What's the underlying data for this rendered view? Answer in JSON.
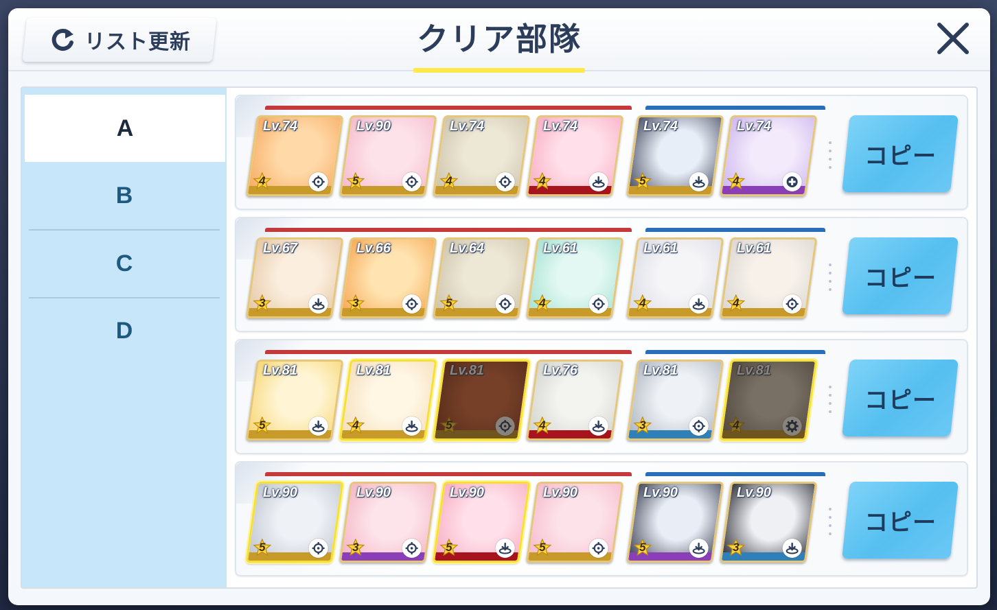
{
  "header": {
    "refresh_label": "リスト更新",
    "title": "クリア部隊"
  },
  "sidebar": {
    "items": [
      {
        "label": "A",
        "active": true
      },
      {
        "label": "B",
        "active": false
      },
      {
        "label": "C",
        "active": false
      },
      {
        "label": "D",
        "active": false
      }
    ]
  },
  "colors": {
    "striker_bar": "#c43a3a",
    "special_bar": "#2a6db8",
    "copy_button": "#55bff0",
    "title_underline": "#ffe94d"
  },
  "copy_label": "コピー",
  "teams": [
    {
      "strikers": [
        {
          "level": "Lv.74",
          "stars": "4",
          "role": "crosshair-icon",
          "base": "#c89a2a",
          "art": [
            "#ffd9a8",
            "#f5a65a"
          ]
        },
        {
          "level": "Lv.90",
          "stars": "5",
          "role": "crosshair-icon",
          "base": "#c89a2a",
          "art": [
            "#fde2ea",
            "#f4b6c8"
          ]
        },
        {
          "level": "Lv.74",
          "stars": "4",
          "role": "crosshair-icon",
          "base": "#c89a2a",
          "art": [
            "#ede7d6",
            "#c9c0a6"
          ]
        },
        {
          "level": "Lv.74",
          "stars": "4",
          "role": "tank-icon",
          "base": "#a8141e",
          "art": [
            "#ffe0ea",
            "#f8a7c0"
          ]
        }
      ],
      "specials": [
        {
          "level": "Lv.74",
          "stars": "5",
          "role": "tank-icon",
          "base": "#c89a2a",
          "art": [
            "#e8eef7",
            "#3b3f55"
          ]
        },
        {
          "level": "Lv.74",
          "stars": "4",
          "role": "heal-icon",
          "base": "#8a3fb8",
          "art": [
            "#f3eafb",
            "#c9b1ee"
          ]
        }
      ]
    },
    {
      "strikers": [
        {
          "level": "Lv.67",
          "stars": "3",
          "role": "tank-icon",
          "base": "#c89a2a",
          "art": [
            "#fbeede",
            "#e2c39e"
          ]
        },
        {
          "level": "Lv.66",
          "stars": "3",
          "role": "crosshair-icon",
          "base": "#c89a2a",
          "art": [
            "#ffe3b0",
            "#f6a24c"
          ]
        },
        {
          "level": "Lv.64",
          "stars": "5",
          "role": "crosshair-icon",
          "base": "#c89a2a",
          "art": [
            "#ede7d6",
            "#c9c0a6"
          ]
        },
        {
          "level": "Lv.61",
          "stars": "4",
          "role": "crosshair-icon",
          "base": "#c89a2a",
          "art": [
            "#e3f8f2",
            "#9fe0d0"
          ]
        }
      ],
      "specials": [
        {
          "level": "Lv.61",
          "stars": "4",
          "role": "tank-icon",
          "base": "#c89a2a",
          "art": [
            "#f5f5f8",
            "#d7d8e0"
          ]
        },
        {
          "level": "Lv.61",
          "stars": "4",
          "role": "crosshair-icon",
          "base": "#c89a2a",
          "art": [
            "#f7f1ea",
            "#d8d3cf"
          ]
        }
      ]
    },
    {
      "strikers": [
        {
          "level": "Lv.81",
          "stars": "5",
          "role": "tank-icon",
          "base": "#c89a2a",
          "art": [
            "#fff5d4",
            "#f6d36a"
          ],
          "gold": false
        },
        {
          "level": "Lv.81",
          "stars": "4",
          "role": "tank-icon",
          "base": "#c89a2a",
          "art": [
            "#fff6e4",
            "#f3dcb6"
          ],
          "gold": true
        },
        {
          "level": "Lv.81",
          "stars": "5",
          "role": "crosshair-icon",
          "base": "#c89a2a",
          "art": [
            "#d46a40",
            "#8a3a22"
          ],
          "gold": true,
          "dim": true
        },
        {
          "level": "Lv.76",
          "stars": "4",
          "role": "tank-icon",
          "base": "#a8141e",
          "art": [
            "#f3f3f0",
            "#cfd0c8"
          ],
          "gold": false
        }
      ],
      "specials": [
        {
          "level": "Lv.81",
          "stars": "3",
          "role": "crosshair-icon",
          "base": "#2f7fb8",
          "art": [
            "#eef2f6",
            "#a8afba"
          ],
          "gold": false
        },
        {
          "level": "Lv.81",
          "stars": "4",
          "role": "gear-icon",
          "base": "#c89a2a",
          "art": [
            "#d9d4c7",
            "#7d7466"
          ],
          "gold": true,
          "dim": true
        }
      ]
    },
    {
      "strikers": [
        {
          "level": "Lv.90",
          "stars": "5",
          "role": "crosshair-icon",
          "base": "#c89a2a",
          "art": [
            "#eef1f6",
            "#b9bfca"
          ],
          "gold": true
        },
        {
          "level": "Lv.90",
          "stars": "3",
          "role": "crosshair-icon",
          "base": "#8a3fb8",
          "art": [
            "#fde3ea",
            "#f3b0c0"
          ],
          "gold": false
        },
        {
          "level": "Lv.90",
          "stars": "5",
          "role": "tank-icon",
          "base": "#a8141e",
          "art": [
            "#ffe0ea",
            "#f8a7c0"
          ],
          "gold": true
        },
        {
          "level": "Lv.90",
          "stars": "5",
          "role": "crosshair-icon",
          "base": "#c89a2a",
          "art": [
            "#fde2ea",
            "#f4b6c8"
          ],
          "gold": false
        }
      ],
      "specials": [
        {
          "level": "Lv.90",
          "stars": "5",
          "role": "tank-icon",
          "base": "#8a3fb8",
          "art": [
            "#e9eef6",
            "#2f3346"
          ],
          "gold": false
        },
        {
          "level": "Lv.90",
          "stars": "3",
          "role": "tank-icon",
          "base": "#2f7fb8",
          "art": [
            "#eef0f4",
            "#1c1d24"
          ],
          "gold": false
        }
      ]
    }
  ]
}
